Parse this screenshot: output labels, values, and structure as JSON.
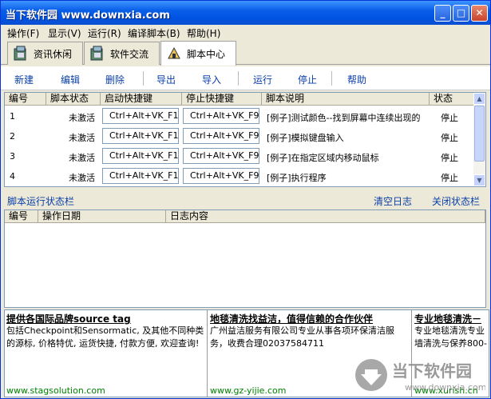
{
  "window": {
    "title": "当下软件园 www.downxia.com"
  },
  "menu": [
    "操作(F)",
    "显示(V)",
    "运行(R)",
    "编译脚本(B)",
    "帮助(H)"
  ],
  "tabs": [
    {
      "label": "资讯休闲",
      "icon": "app-icon"
    },
    {
      "label": "软件交流",
      "icon": "app-icon"
    },
    {
      "label": "脚本中心",
      "icon": "script-icon"
    }
  ],
  "toolbar": {
    "new": "新建",
    "edit": "编辑",
    "delete": "删除",
    "export": "导出",
    "import": "导入",
    "run": "运行",
    "stop": "停止",
    "help": "帮助"
  },
  "scripts": {
    "headers": [
      "编号",
      "脚本状态",
      "启动快捷键",
      "停止快捷键",
      "脚本说明",
      "状态"
    ],
    "rows": [
      {
        "id": "1",
        "state": "未激活",
        "start": "Ctrl+Alt+VK_F1",
        "stop": "Ctrl+Alt+VK_F9",
        "desc": "[例子]测试颜色--找到屏幕中连续出现的",
        "status": "停止"
      },
      {
        "id": "2",
        "state": "未激活",
        "start": "Ctrl+Alt+VK_F1",
        "stop": "Ctrl+Alt+VK_F9",
        "desc": "[例子]模拟键盘输入",
        "status": "停止"
      },
      {
        "id": "3",
        "state": "未激活",
        "start": "Ctrl+Alt+VK_F1",
        "stop": "Ctrl+Alt+VK_F9",
        "desc": "[例子]在指定区域内移动鼠标",
        "status": "停止"
      },
      {
        "id": "4",
        "state": "未激活",
        "start": "Ctrl+Alt+VK_F1",
        "stop": "Ctrl+Alt+VK_F9",
        "desc": "[例子]执行程序",
        "status": "停止"
      }
    ]
  },
  "statusbar": {
    "title": "脚本运行状态栏",
    "clear": "清空日志",
    "close": "关闭状态栏"
  },
  "log": {
    "headers": [
      "编号",
      "操作日期",
      "日志内容"
    ]
  },
  "ads": [
    {
      "title": "提供各国际品牌source tag",
      "body": "包括Checkpoint和Sensormatic, 及其他不同种类的源标, 价格特优, 运货快捷, 付款方便, 欢迎查询!",
      "url": "www.stagsolution.com"
    },
    {
      "title": "地毯清洗找益洁，值得信赖的合作伙伴",
      "body": "广州益洁服务有限公司专业从事各项环保清洁服务，收费合理02037584711",
      "url": "www.gz-yijie.com"
    },
    {
      "title": "专业地毯清洗－",
      "body": "专业地毯清洗专业墙清洗与保养800-",
      "url": "www.xurish.cn"
    }
  ],
  "watermark": {
    "text": "当下软件园",
    "url": "www.downxia.com"
  }
}
